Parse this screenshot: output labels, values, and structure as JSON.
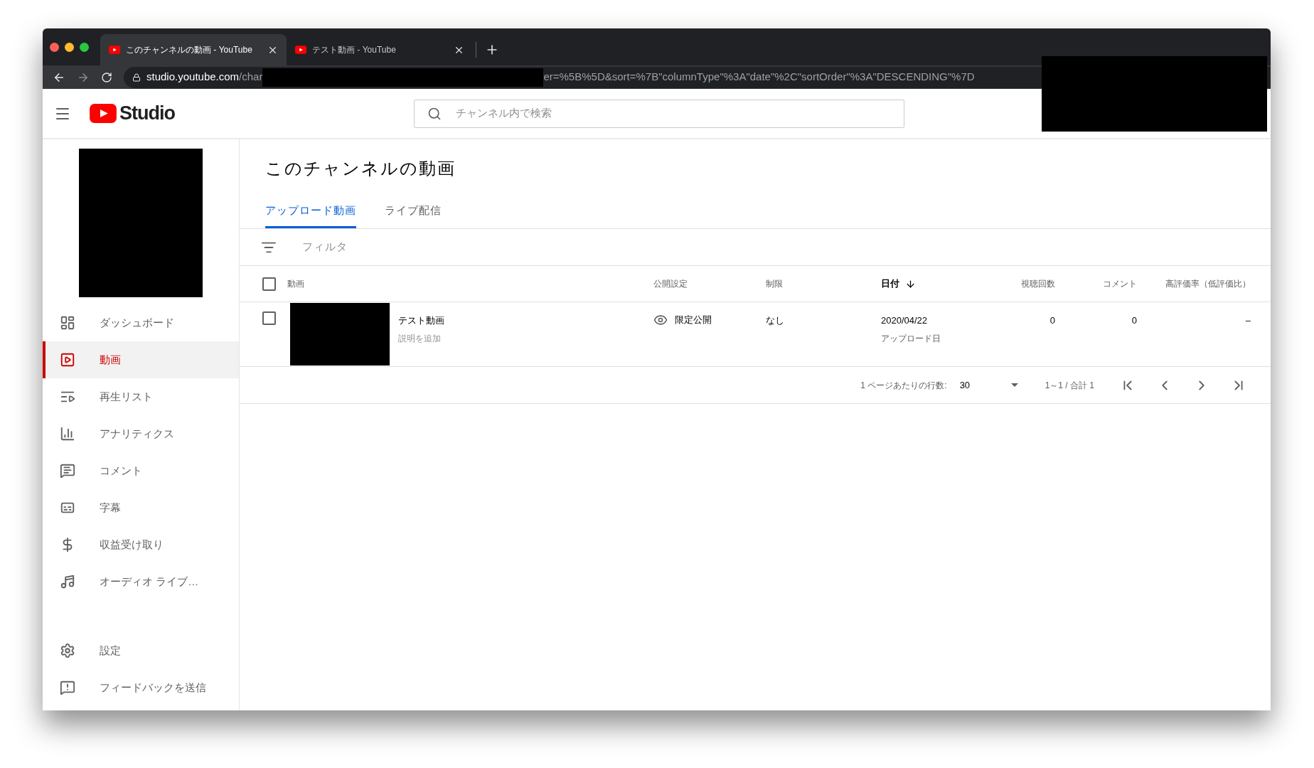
{
  "browser": {
    "tabs": [
      {
        "title": "このチャンネルの動画 - YouTube",
        "selected": true
      },
      {
        "title": "テスト動画 - YouTube",
        "selected": false
      }
    ],
    "url_host": "studio.youtube.com",
    "url_start": "/char",
    "url_end": "er=%5B%5D&sort=%7B\"columnType\"%3A\"date\"%2C\"sortOrder\"%3A\"DESCENDING\"%7D"
  },
  "header": {
    "logo_text": "Studio",
    "search": {
      "placeholder": "チャンネル内で検索"
    }
  },
  "sidebar": {
    "items": [
      {
        "label": "ダッシュボード",
        "selected": false
      },
      {
        "label": "動画",
        "selected": true
      },
      {
        "label": "再生リスト",
        "selected": false
      },
      {
        "label": "アナリティクス",
        "selected": false
      },
      {
        "label": "コメント",
        "selected": false
      },
      {
        "label": "字幕",
        "selected": false
      },
      {
        "label": "収益受け取り",
        "selected": false
      },
      {
        "label": "オーディオ ライブ…",
        "selected": false
      }
    ],
    "bottom_items": [
      {
        "label": "設定"
      },
      {
        "label": "フィードバックを送信"
      }
    ]
  },
  "main": {
    "title": "このチャンネルの動画",
    "tabs": [
      {
        "label": "アップロード動画",
        "selected": true
      },
      {
        "label": "ライブ配信",
        "selected": false
      }
    ],
    "filter": {
      "placeholder": "フィルタ"
    },
    "table": {
      "all_checked": false,
      "columns": [
        {
          "label": "動画",
          "sorted": false
        },
        {
          "label": "公開設定",
          "sorted": false
        },
        {
          "label": "制限",
          "sorted": false
        },
        {
          "label": "日付",
          "sorted": true
        },
        {
          "label": "視聴回数",
          "sorted": false
        },
        {
          "label": "コメント",
          "sorted": false
        },
        {
          "label": "高評価率（低評価比）",
          "sorted": false
        }
      ],
      "rows": [
        {
          "checked": false,
          "title": "テスト動画",
          "description": "説明を追加",
          "visibility": "限定公開",
          "restriction": "なし",
          "date": "2020/04/22",
          "date_label": "アップロード日",
          "views": "0",
          "comments": "0",
          "rating": "–"
        }
      ]
    },
    "pagination": {
      "rows_per_page_label": "1 ページあたりの行数:",
      "rows_per_page": "30",
      "range": "1～1 / 合計 1"
    }
  }
}
